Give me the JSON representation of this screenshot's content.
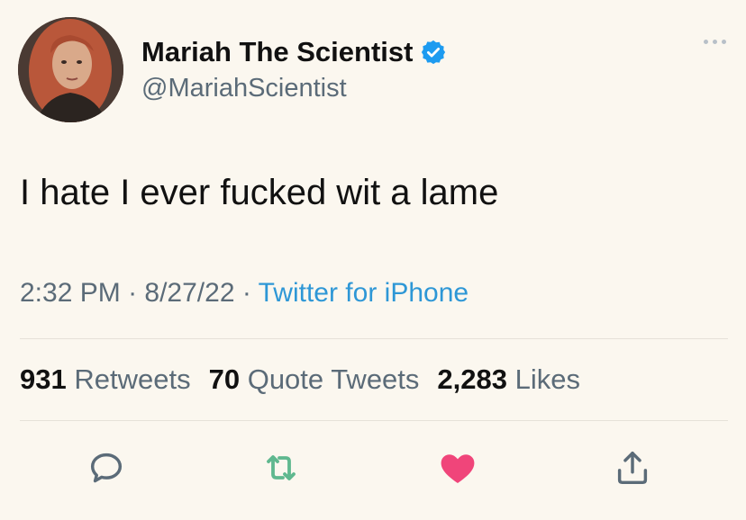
{
  "tweet": {
    "display_name": "Mariah The Scientist",
    "handle": "@MariahScientist",
    "text": "I hate I ever fucked wit a lame",
    "time": "2:32 PM",
    "date": "8/27/22",
    "source": "Twitter for iPhone",
    "separator": " · "
  },
  "stats": {
    "retweets_count": "931",
    "retweets_label": "Retweets",
    "quote_count": "70",
    "quote_label": "Quote Tweets",
    "likes_count": "2,283",
    "likes_label": "Likes"
  },
  "colors": {
    "background": "#fbf7ef",
    "verified": "#1d9bf0",
    "source_link": "#2e97d6",
    "retweet_icon": "#5fb88f",
    "like_icon": "#f0457a",
    "muted_text": "#5b6b78"
  },
  "icons": {
    "verified": "verified-badge-icon",
    "more": "more-options-icon",
    "reply": "reply-icon",
    "retweet": "retweet-icon",
    "like": "heart-icon",
    "share": "share-icon"
  }
}
